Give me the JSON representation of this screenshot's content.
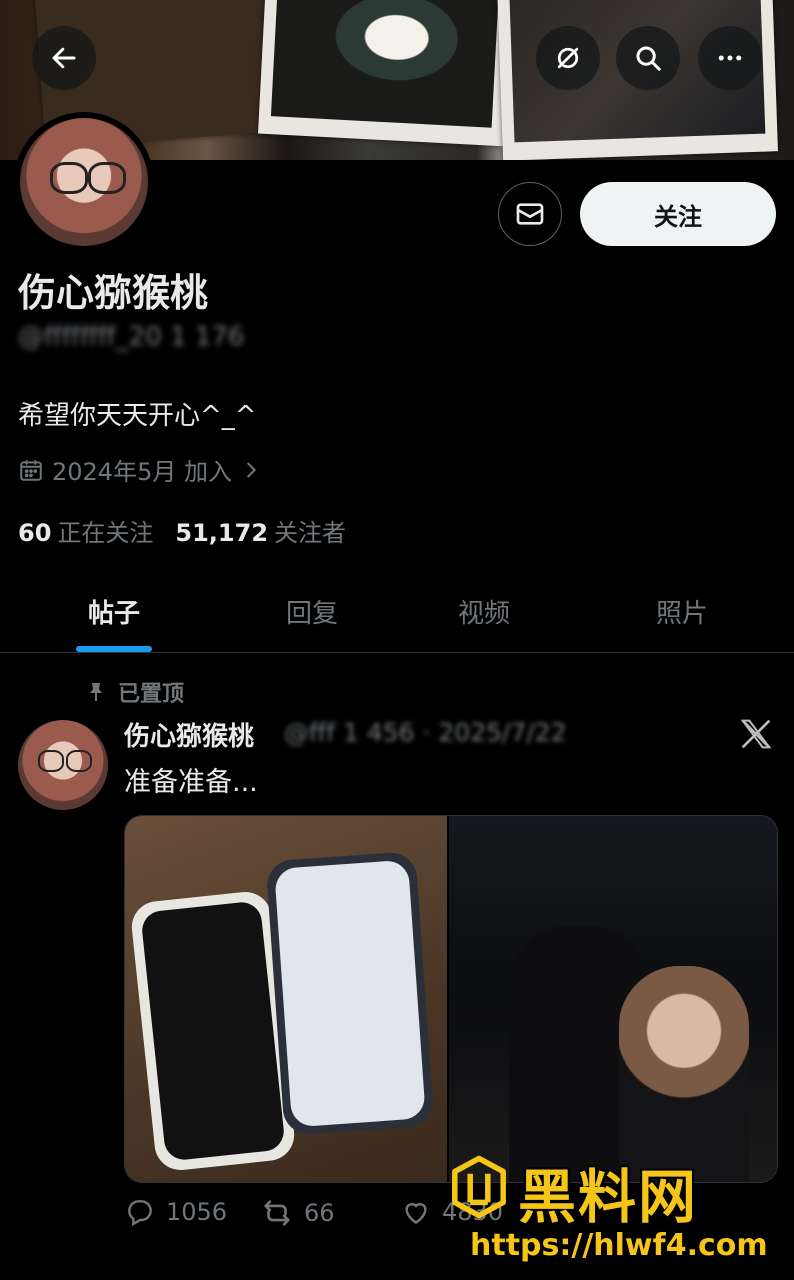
{
  "header": {
    "back_icon": "arrow-left-icon",
    "grok_icon": "grok-icon",
    "search_icon": "search-icon",
    "more_icon": "more-icon"
  },
  "profile": {
    "display_name": "伤心猕猴桃",
    "handle": "@ffffffff_20 1 176",
    "bio": "希望你天天开心^_^",
    "joined": "2024年5月 加入",
    "following_count": "60",
    "following_label": "正在关注",
    "followers_count": "51,172",
    "followers_label": "关注者",
    "follow_button": "关注",
    "message_icon": "mail-icon"
  },
  "tabs": [
    {
      "label": "帖子",
      "active": true
    },
    {
      "label": "回复",
      "active": false
    },
    {
      "label": "视频",
      "active": false
    },
    {
      "label": "照片",
      "active": false
    }
  ],
  "post": {
    "pinned_label": "已置顶",
    "author_name": "伤心猕猴桃",
    "author_handle": "@fff  1  456 · 2025/7/22",
    "text": "准备准备...",
    "replies": "1056",
    "reposts": "66",
    "likes": "4830"
  },
  "watermark": {
    "title": "黑料网",
    "url": "https://hlwf4.com"
  },
  "colors": {
    "accent": "#1d9bf0",
    "background": "#000000",
    "muted_text": "#71767b",
    "watermark": "#f5c518"
  }
}
